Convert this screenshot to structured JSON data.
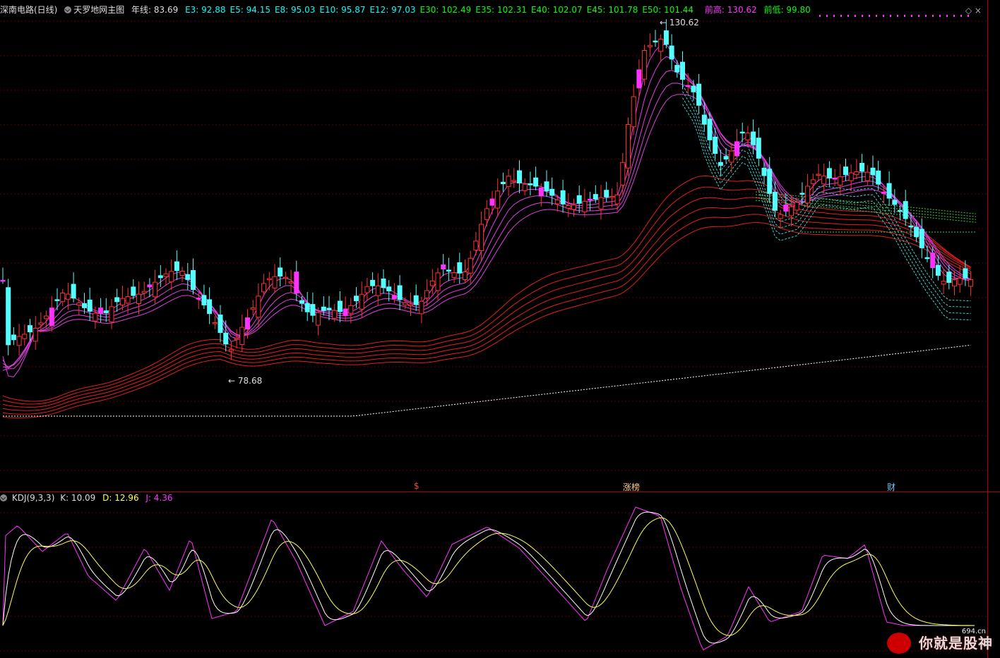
{
  "header": {
    "stock": "深南电路(日线)",
    "indicator": "天罗地网主图",
    "year_line": "年线: 83.69",
    "emas": [
      {
        "label": "E3: 92.88",
        "color": "#00ffff"
      },
      {
        "label": "E5: 94.15",
        "color": "#00ffff"
      },
      {
        "label": "E8: 95.03",
        "color": "#00ffff"
      },
      {
        "label": "E10: 95.87",
        "color": "#00ffff"
      },
      {
        "label": "E12: 97.03",
        "color": "#00ffff"
      },
      {
        "label": "E30: 102.49",
        "color": "#00ff00"
      },
      {
        "label": "E35: 102.31",
        "color": "#00ff00"
      },
      {
        "label": "E40: 102.07",
        "color": "#00ff00"
      },
      {
        "label": "E45: 101.78",
        "color": "#00ff00"
      },
      {
        "label": "E50: 101.44",
        "color": "#00ff00"
      }
    ],
    "prev_high": "前高: 130.62",
    "prev_low": "前低: 99.80"
  },
  "annotations": {
    "high_label": "130.62",
    "low_label": "78.68",
    "markers": [
      "$",
      "涨榜",
      "财"
    ]
  },
  "kdj": {
    "name": "KDJ(9,3,3)",
    "k": "K: 10.09",
    "d": "D: 12.96",
    "j": "J: 4.36"
  },
  "watermark": {
    "text": "你就是股神",
    "site": "694.cn"
  },
  "colors": {
    "up": "#ff3333",
    "down": "#54ffff",
    "magenta": "#ff33ff",
    "background": "#000000"
  }
}
